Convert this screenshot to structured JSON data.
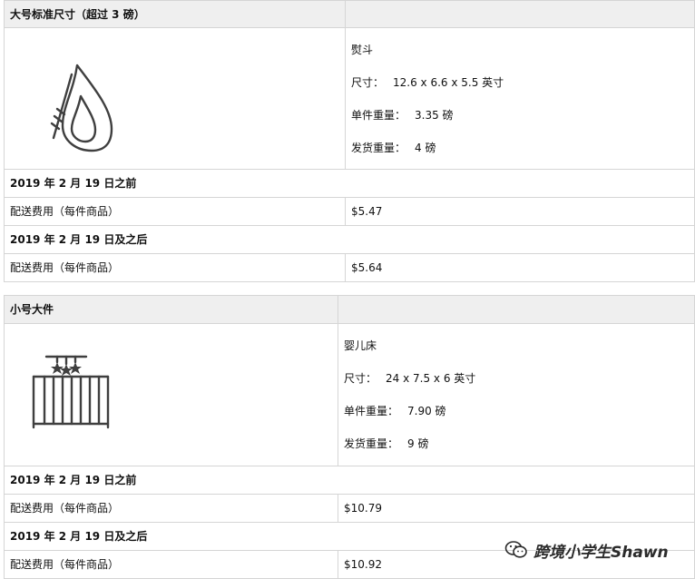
{
  "sections": [
    {
      "header": "大号标准尺寸（超过 3 磅）",
      "product": {
        "icon": "clothes-iron-icon",
        "name": "熨斗",
        "size_label": "尺寸：",
        "size_value": "12.6 x 6.6 x 5.5 英寸",
        "unit_weight_label": "单件重量：",
        "unit_weight_value": "3.35 磅",
        "ship_weight_label": "发货重量：",
        "ship_weight_value": "4 磅"
      },
      "before_label": "2019 年 2 月 19 日之前",
      "before_fee_label": "配送费用（每件商品）",
      "before_fee_value": "$5.47",
      "after_label": "2019 年 2 月 19 日及之后",
      "after_fee_label": "配送费用（每件商品）",
      "after_fee_value": "$5.64"
    },
    {
      "header": "小号大件",
      "product": {
        "icon": "baby-crib-icon",
        "name": "婴儿床",
        "size_label": "尺寸：",
        "size_value": "24 x 7.5 x 6 英寸",
        "unit_weight_label": "单件重量：",
        "unit_weight_value": "7.90 磅",
        "ship_weight_label": "发货重量：",
        "ship_weight_value": "9 磅"
      },
      "before_label": "2019 年 2 月 19 日之前",
      "before_fee_label": "配送费用（每件商品）",
      "before_fee_value": "$10.79",
      "after_label": "2019 年 2 月 19 日及之后",
      "after_fee_label": "配送费用（每件商品）",
      "after_fee_value": "$10.92"
    }
  ],
  "watermark": {
    "icon": "wechat-logo-icon",
    "text": "跨境小学生Shawn"
  }
}
